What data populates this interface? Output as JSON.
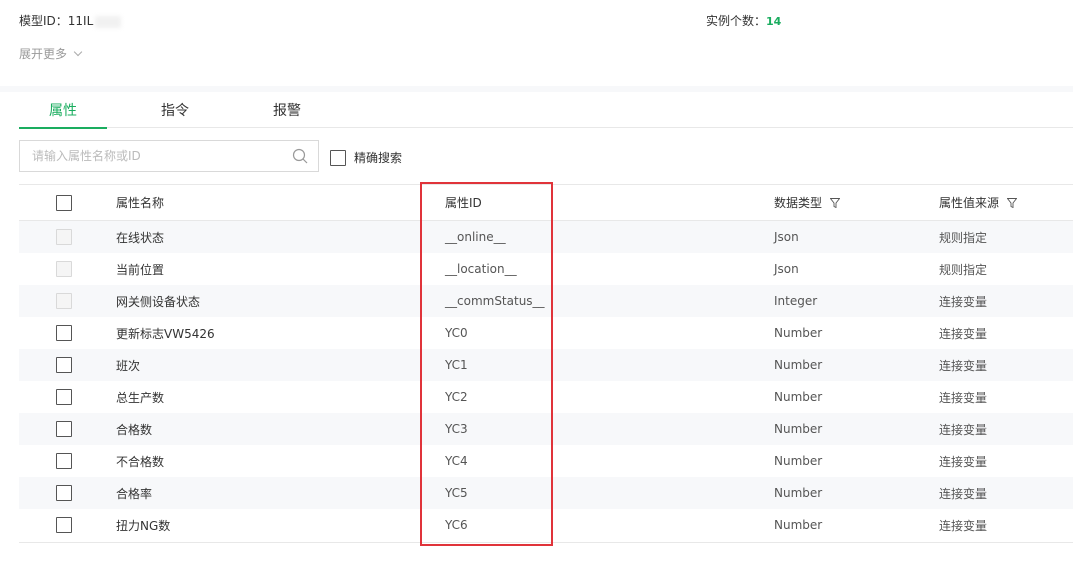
{
  "header": {
    "model_id_label": "模型ID：11IL",
    "instance_label": "实例个数：",
    "instance_count": "14",
    "expand_more": "展开更多"
  },
  "tabs": [
    {
      "label": "属性",
      "active": true
    },
    {
      "label": "指令",
      "active": false
    },
    {
      "label": "报警",
      "active": false
    }
  ],
  "search": {
    "placeholder": "请输入属性名称或ID",
    "exact_label": "精确搜索"
  },
  "table": {
    "columns": {
      "name": "属性名称",
      "id": "属性ID",
      "type": "数据类型",
      "source": "属性值来源"
    },
    "rows": [
      {
        "name": "在线状态",
        "id": "__online__",
        "type": "Json",
        "source": "规则指定",
        "checkbox_disabled": true
      },
      {
        "name": "当前位置",
        "id": "__location__",
        "type": "Json",
        "source": "规则指定",
        "checkbox_disabled": true
      },
      {
        "name": "网关侧设备状态",
        "id": "__commStatus__",
        "type": "Integer",
        "source": "连接变量",
        "checkbox_disabled": true
      },
      {
        "name": "更新标志VW5426",
        "id": "YC0",
        "type": "Number",
        "source": "连接变量",
        "checkbox_disabled": false
      },
      {
        "name": "班次",
        "id": "YC1",
        "type": "Number",
        "source": "连接变量",
        "checkbox_disabled": false
      },
      {
        "name": "总生产数",
        "id": "YC2",
        "type": "Number",
        "source": "连接变量",
        "checkbox_disabled": false
      },
      {
        "name": "合格数",
        "id": "YC3",
        "type": "Number",
        "source": "连接变量",
        "checkbox_disabled": false
      },
      {
        "name": "不合格数",
        "id": "YC4",
        "type": "Number",
        "source": "连接变量",
        "checkbox_disabled": false
      },
      {
        "name": "合格率",
        "id": "YC5",
        "type": "Number",
        "source": "连接变量",
        "checkbox_disabled": false
      },
      {
        "name": "扭力NG数",
        "id": "YC6",
        "type": "Number",
        "source": "连接变量",
        "checkbox_disabled": false
      }
    ]
  },
  "colors": {
    "accent": "#1aad5f",
    "highlight": "#e0333a",
    "stripe": "#f7f8fa"
  }
}
